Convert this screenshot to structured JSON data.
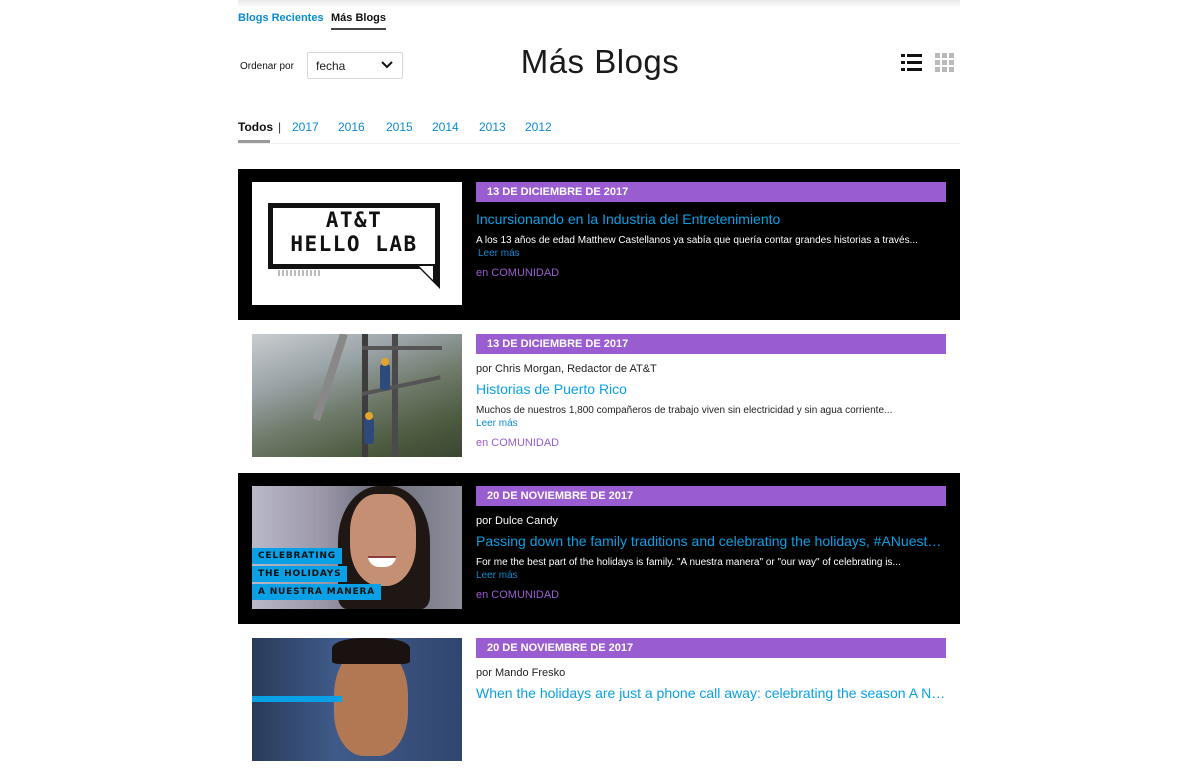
{
  "nav": {
    "recent_label": "Blogs Recientes",
    "more_label": "Más Blogs"
  },
  "sort": {
    "label": "Ordenar por",
    "value": "fecha"
  },
  "page_title": "Más Blogs",
  "view_modes": {
    "list_icon": "list-view-icon",
    "grid_icon": "grid-view-icon",
    "active": "list"
  },
  "year_filter": {
    "all_label": "Todos",
    "separator": "|",
    "years": [
      "2017",
      "2016",
      "2015",
      "2014",
      "2013",
      "2012"
    ]
  },
  "colors": {
    "accent_blue": "#0a8ad2",
    "headline_blue": "#0aa0e6",
    "date_purple": "#9a5dd1"
  },
  "posts": [
    {
      "date": "13 DE DICIEMBRE DE 2017",
      "author": "",
      "title": "Incursionando en la Industria del Entretenimiento",
      "excerpt": "A los 13 años de edad Matthew Castellanos ya sabía que quería contar grandes historias a través...",
      "read_more": "Leer más",
      "category": "en COMUNIDAD",
      "thumb_text_line1": "AT&T",
      "thumb_text_line2": "HELLO LAB"
    },
    {
      "date": "13 DE DICIEMBRE DE 2017",
      "author": "por Chris Morgan, Redactor de AT&T",
      "title": "Historias de Puerto Rico",
      "excerpt": "Muchos de nuestros 1,800 compañeros de trabajo viven sin electricidad y sin agua corriente...",
      "read_more": "Leer más",
      "category": "en COMUNIDAD"
    },
    {
      "date": "20 DE NOVIEMBRE DE 2017",
      "author": "por Dulce Candy",
      "title": "Passing down the family traditions and celebrating the holidays, #ANuestraManera",
      "excerpt": "For me the best part of the holidays is family. \"A nuestra manera\" or \"our way\" of celebrating is...",
      "read_more": "Leer más",
      "category": "en COMUNIDAD",
      "thumb_labels": [
        "CELEBRATING",
        "THE HOLIDAYS",
        "A NUESTRA MANERA"
      ]
    },
    {
      "date": "20 DE NOVIEMBRE DE 2017",
      "author": "por Mando Fresko",
      "title": "When the holidays are just a phone call away: celebrating the season A Nuestra Manera",
      "excerpt": "",
      "read_more": "",
      "category": ""
    }
  ]
}
